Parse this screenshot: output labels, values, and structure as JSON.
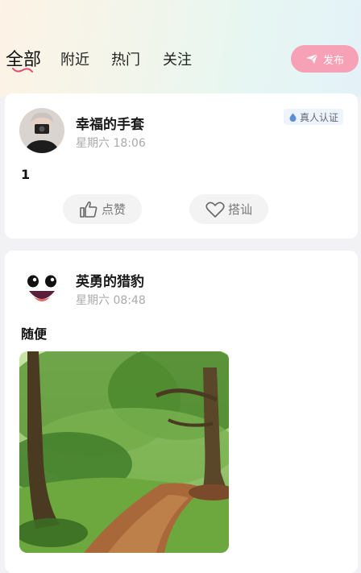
{
  "tabs": [
    {
      "label": "全部",
      "active": true
    },
    {
      "label": "附近"
    },
    {
      "label": "热门"
    },
    {
      "label": "关注"
    }
  ],
  "publish": {
    "label": "发布",
    "color": "#f7a1b6"
  },
  "posts": [
    {
      "username": "幸福的手套",
      "time": "星期六 18:06",
      "badge": "真人认证",
      "text": "1",
      "actions": {
        "like": "点赞",
        "chat": "搭讪"
      }
    },
    {
      "username": "英勇的猎豹",
      "time": "星期六 08:48",
      "text": "随便",
      "image": "forest-path-photo"
    }
  ]
}
